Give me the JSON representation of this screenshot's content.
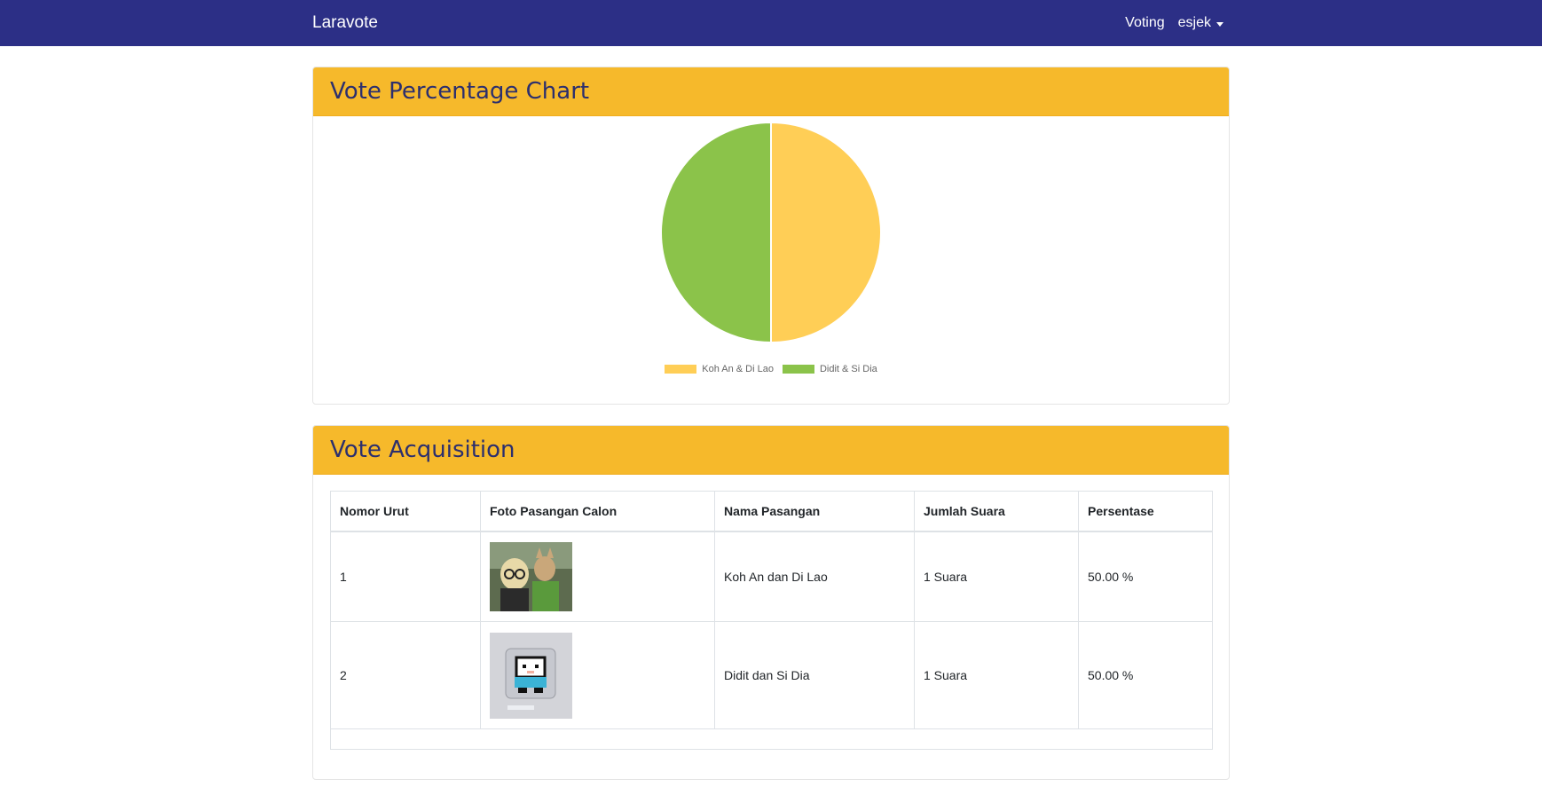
{
  "navbar": {
    "brand": "Laravote",
    "voting_link": "Voting",
    "user_name": "esjek"
  },
  "chart_card": {
    "title": "Vote Percentage Chart"
  },
  "chart_data": {
    "type": "pie",
    "labels": [
      "Koh An & Di Lao",
      "Didit & Si Dia"
    ],
    "values": [
      50,
      50
    ],
    "colors": [
      "#ffce56",
      "#8bc34a"
    ],
    "legend_position": "bottom"
  },
  "table_card": {
    "title": "Vote Acquisition",
    "columns": [
      "Nomor Urut",
      "Foto Pasangan Calon",
      "Nama Pasangan",
      "Jumlah Suara",
      "Persentase"
    ],
    "rows": [
      {
        "number": "1",
        "photo_icon": "couple-photo-1",
        "name": "Koh An dan Di Lao",
        "votes": "1 Suara",
        "percentage": "50.00 %"
      },
      {
        "number": "2",
        "photo_icon": "couple-photo-2",
        "name": "Didit dan Si Dia",
        "votes": "1 Suara",
        "percentage": "50.00 %"
      }
    ]
  }
}
